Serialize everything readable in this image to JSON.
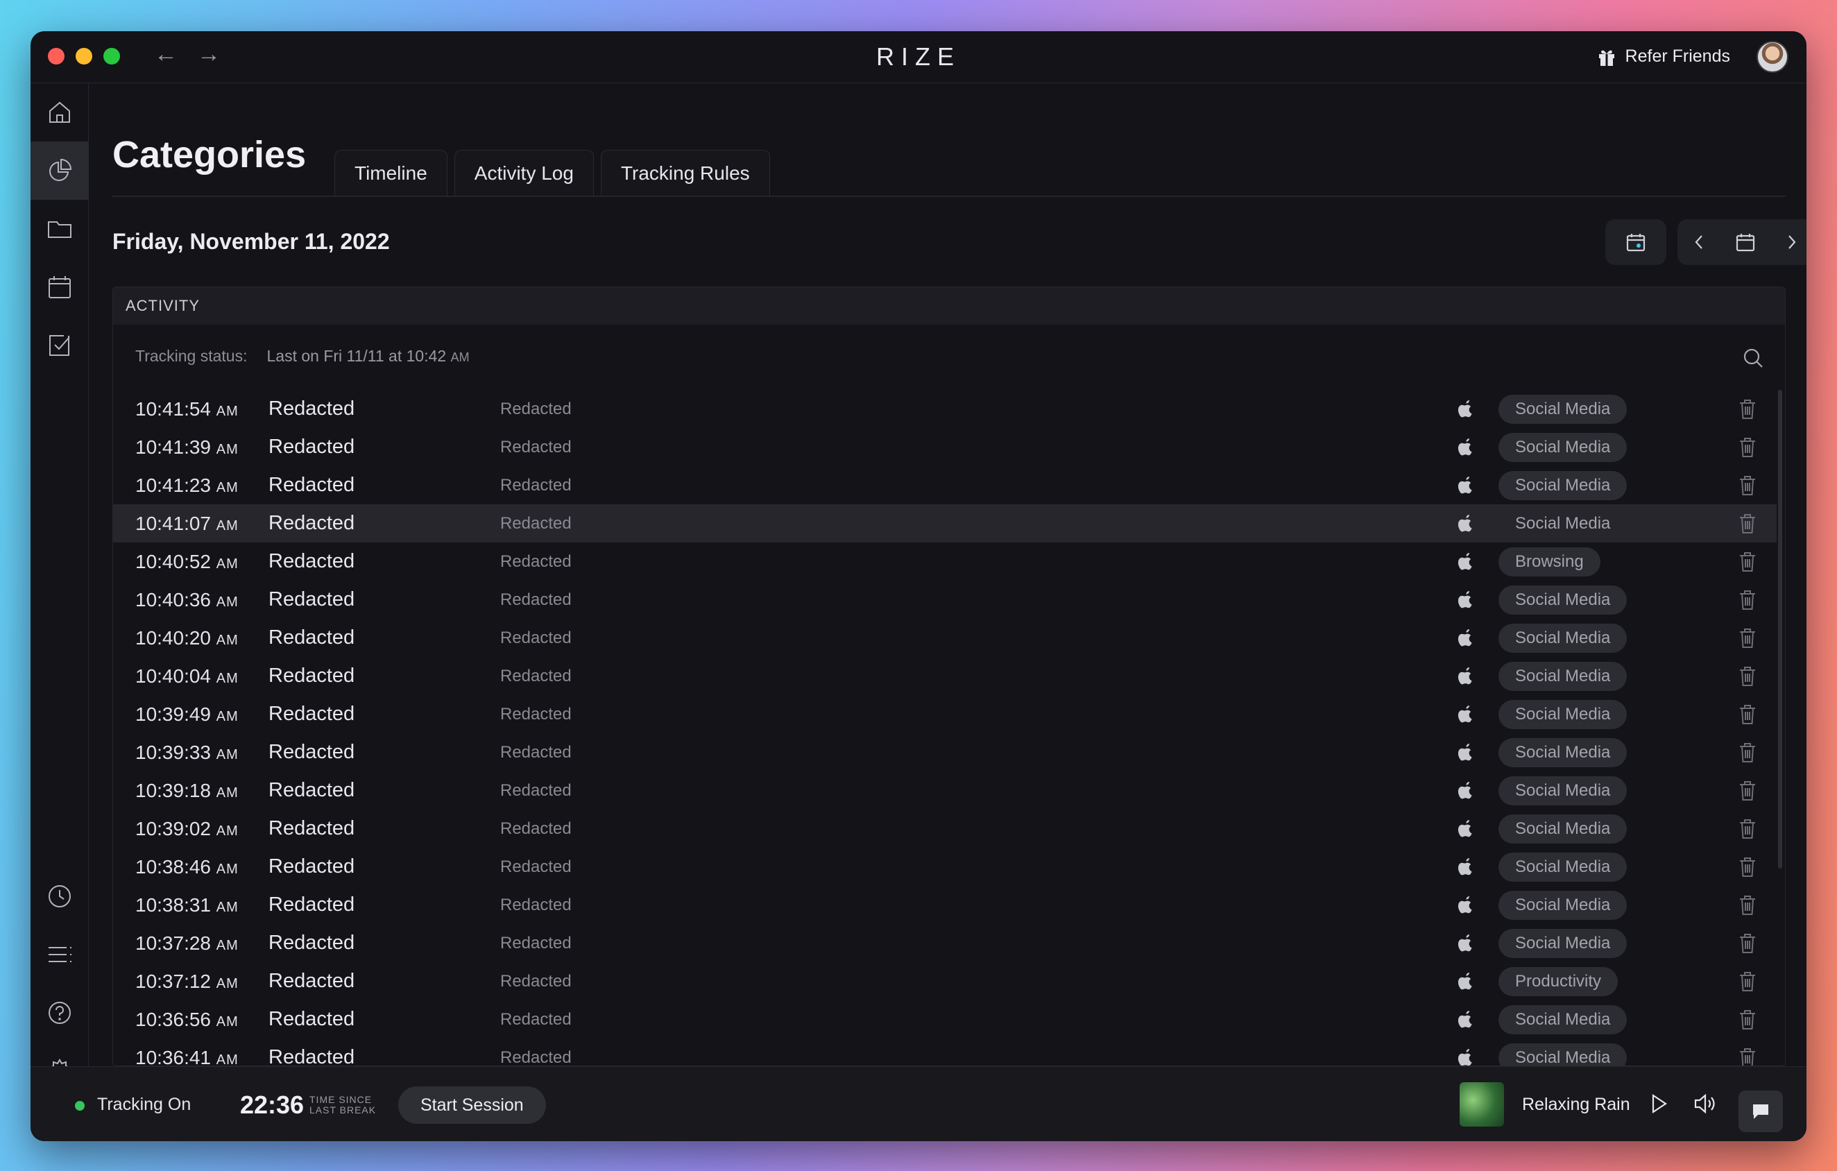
{
  "app": {
    "title": "RIZE",
    "refer_label": "Refer Friends"
  },
  "page": {
    "title": "Categories",
    "tabs": [
      "Timeline",
      "Activity Log",
      "Tracking Rules"
    ],
    "date": "Friday, November 11, 2022"
  },
  "activity": {
    "header": "ACTIVITY",
    "status_label": "Tracking status:",
    "status_value": "Last on Fri 11/11 at 10:42",
    "status_value_ampm": "AM",
    "rows": [
      {
        "time": "10:41:54",
        "ampm": "AM",
        "title": "Redacted",
        "subtitle": "Redacted",
        "category": "Social Media"
      },
      {
        "time": "10:41:39",
        "ampm": "AM",
        "title": "Redacted",
        "subtitle": "Redacted",
        "category": "Social Media"
      },
      {
        "time": "10:41:23",
        "ampm": "AM",
        "title": "Redacted",
        "subtitle": "Redacted",
        "category": "Social Media"
      },
      {
        "time": "10:41:07",
        "ampm": "AM",
        "title": "Redacted",
        "subtitle": "Redacted",
        "category": "Social Media",
        "highlighted": true
      },
      {
        "time": "10:40:52",
        "ampm": "AM",
        "title": "Redacted",
        "subtitle": "Redacted",
        "category": "Browsing"
      },
      {
        "time": "10:40:36",
        "ampm": "AM",
        "title": "Redacted",
        "subtitle": "Redacted",
        "category": "Social Media"
      },
      {
        "time": "10:40:20",
        "ampm": "AM",
        "title": "Redacted",
        "subtitle": "Redacted",
        "category": "Social Media"
      },
      {
        "time": "10:40:04",
        "ampm": "AM",
        "title": "Redacted",
        "subtitle": "Redacted",
        "category": "Social Media"
      },
      {
        "time": "10:39:49",
        "ampm": "AM",
        "title": "Redacted",
        "subtitle": "Redacted",
        "category": "Social Media"
      },
      {
        "time": "10:39:33",
        "ampm": "AM",
        "title": "Redacted",
        "subtitle": "Redacted",
        "category": "Social Media"
      },
      {
        "time": "10:39:18",
        "ampm": "AM",
        "title": "Redacted",
        "subtitle": "Redacted",
        "category": "Social Media"
      },
      {
        "time": "10:39:02",
        "ampm": "AM",
        "title": "Redacted",
        "subtitle": "Redacted",
        "category": "Social Media"
      },
      {
        "time": "10:38:46",
        "ampm": "AM",
        "title": "Redacted",
        "subtitle": "Redacted",
        "category": "Social Media"
      },
      {
        "time": "10:38:31",
        "ampm": "AM",
        "title": "Redacted",
        "subtitle": "Redacted",
        "category": "Social Media"
      },
      {
        "time": "10:37:28",
        "ampm": "AM",
        "title": "Redacted",
        "subtitle": "Redacted",
        "category": "Social Media"
      },
      {
        "time": "10:37:12",
        "ampm": "AM",
        "title": "Redacted",
        "subtitle": "Redacted",
        "category": "Productivity"
      },
      {
        "time": "10:36:56",
        "ampm": "AM",
        "title": "Redacted",
        "subtitle": "Redacted",
        "category": "Social Media"
      },
      {
        "time": "10:36:41",
        "ampm": "AM",
        "title": "Redacted",
        "subtitle": "Redacted",
        "category": "Social Media"
      }
    ]
  },
  "footer": {
    "tracking_label": "Tracking On",
    "timer": "22:36",
    "timer_label_line1": "TIME SINCE",
    "timer_label_line2": "LAST BREAK",
    "start_session": "Start Session",
    "music_title": "Relaxing Rain"
  },
  "colors": {
    "background": "#131318",
    "accent_green": "#35c759",
    "pill": "#2c2c33"
  },
  "icons": [
    "home-icon",
    "pie-chart-icon",
    "folder-icon",
    "calendar-icon",
    "checkbox-icon",
    "clock-icon",
    "list-icon",
    "help-icon",
    "settings-icon",
    "gift-icon",
    "search-icon",
    "apple-icon",
    "trash-icon",
    "play-icon",
    "volume-icon",
    "chat-icon"
  ]
}
